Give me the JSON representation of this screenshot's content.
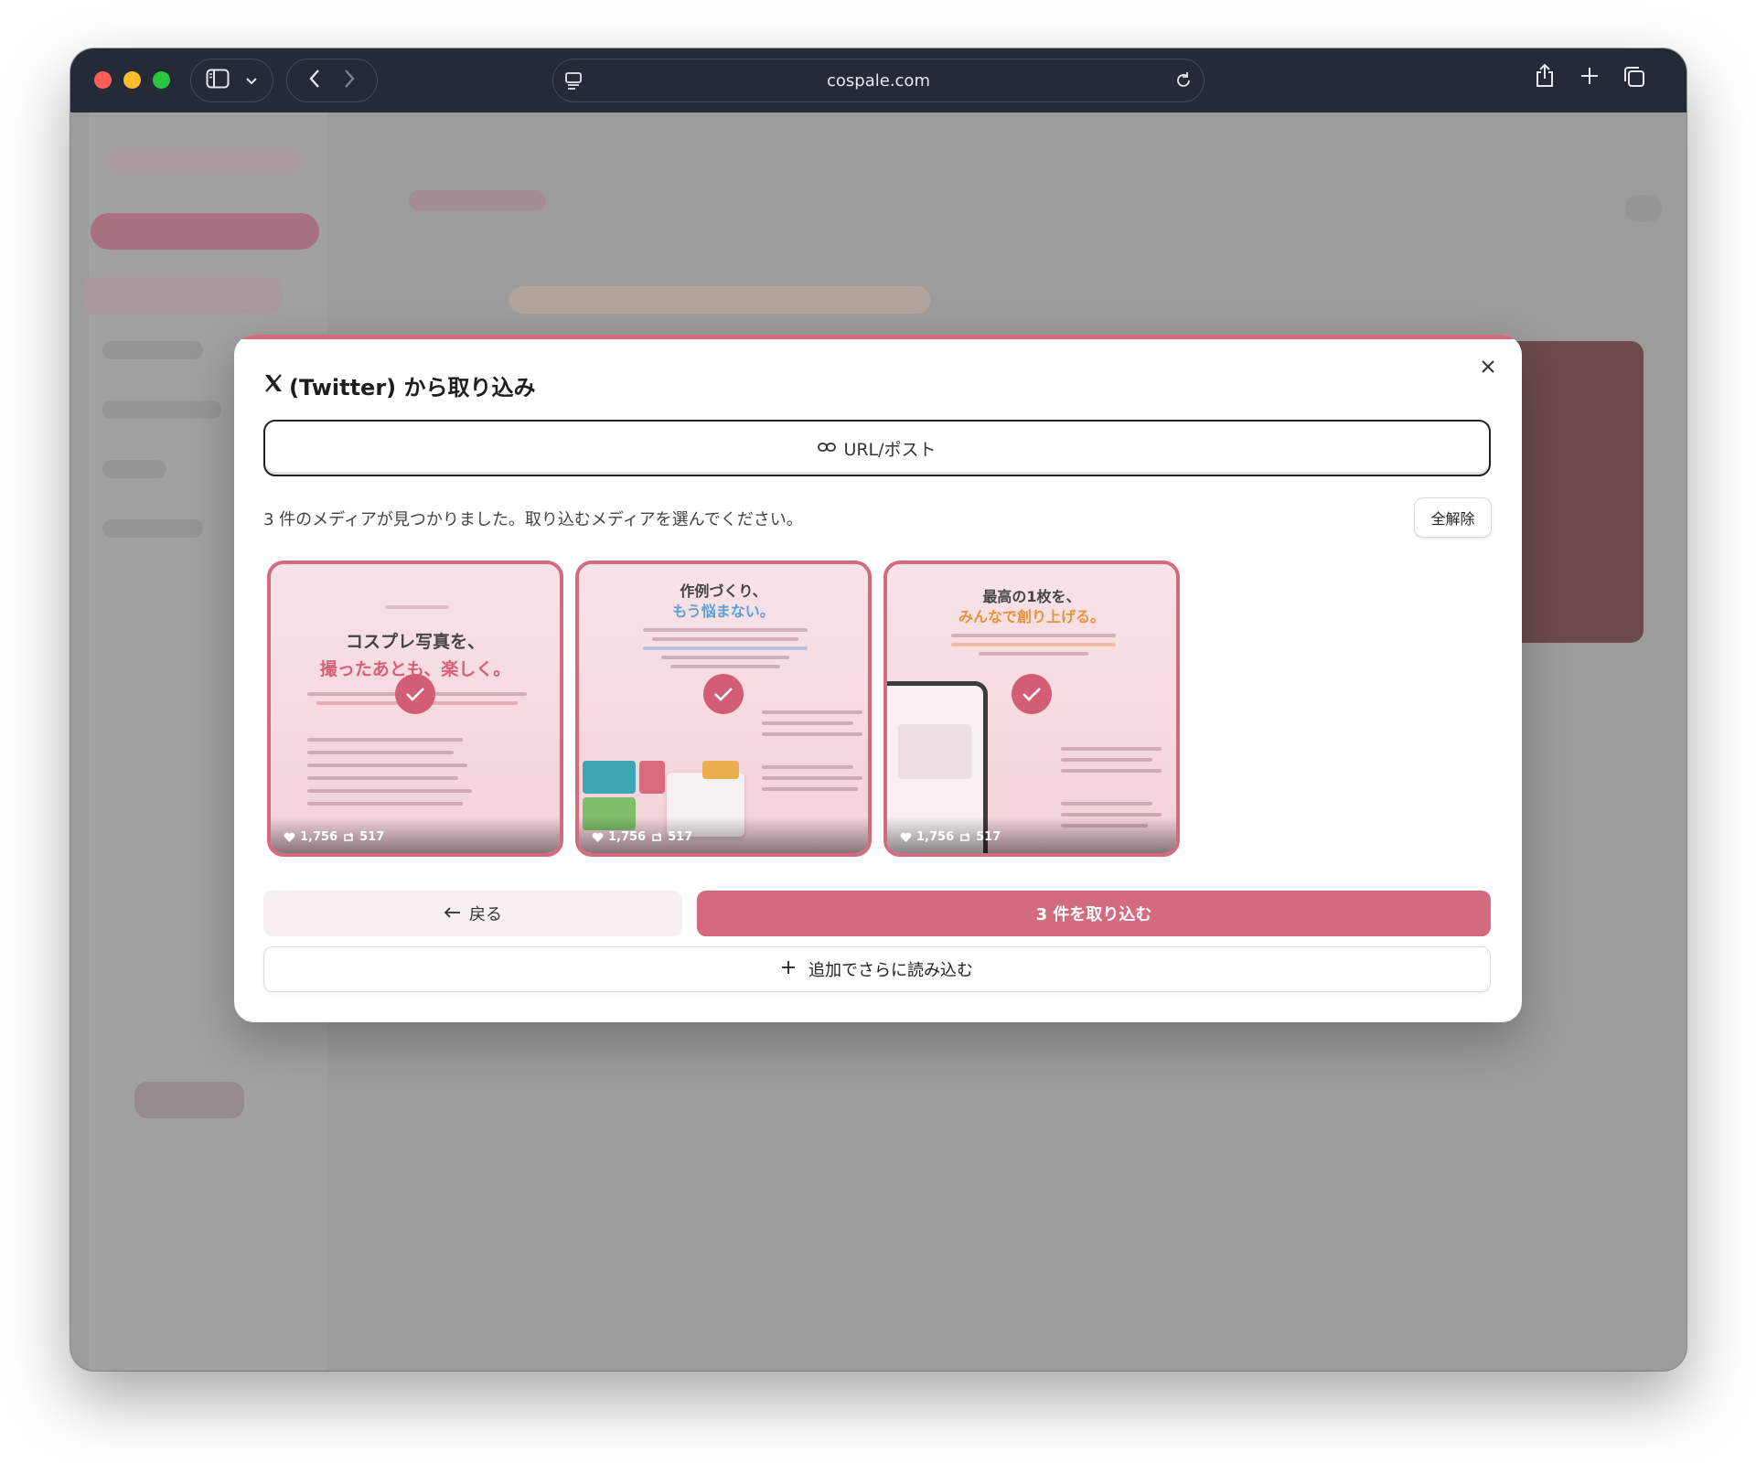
{
  "browser": {
    "url": "cospale.com"
  },
  "modal": {
    "title": "(Twitter) から取り込み",
    "url_button_label": "URL/ポスト",
    "info_text": "3 件のメディアが見つかりました。取り込むメディアを選んでください。",
    "deselect_all_label": "全解除",
    "media": [
      {
        "title": "コスプレ写真を、",
        "subtitle": "撮ったあとも、楽しく。",
        "likes": "1,756",
        "reposts": "517"
      },
      {
        "title": "作例づくり、",
        "subtitle": "もう悩まない。",
        "likes": "1,756",
        "reposts": "517"
      },
      {
        "title": "最高の1枚を、",
        "subtitle": "みんなで創り上げる。",
        "likes": "1,756",
        "reposts": "517"
      }
    ],
    "back_label": "戻る",
    "import_label": "3 件を取り込む",
    "load_more_label": "追加でさらに読み込む"
  },
  "colors": {
    "accent": "#d46a7e",
    "check": "#d35d74",
    "subtitle_1": "#d85f78",
    "subtitle_2": "#5b9fd6",
    "subtitle_3": "#e8923a"
  }
}
